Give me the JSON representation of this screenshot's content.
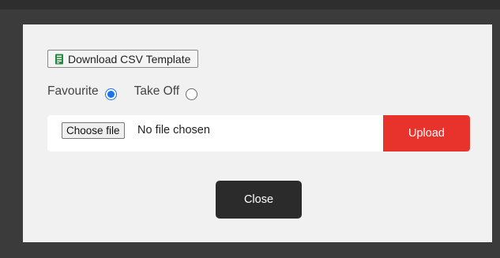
{
  "modal": {
    "download_button": {
      "label": "Download CSV Template",
      "icon": "csv-file-icon",
      "icon_color": "#1e8a3a"
    },
    "radio_options": [
      {
        "label": "Favourite",
        "checked": true
      },
      {
        "label": "Take Off",
        "checked": false
      }
    ],
    "file_input": {
      "choose_label": "Choose file",
      "status": "No file chosen"
    },
    "upload_button": {
      "label": "Upload",
      "color": "#e8322c"
    },
    "close_button": {
      "label": "Close",
      "color": "#2b2b2b"
    }
  }
}
